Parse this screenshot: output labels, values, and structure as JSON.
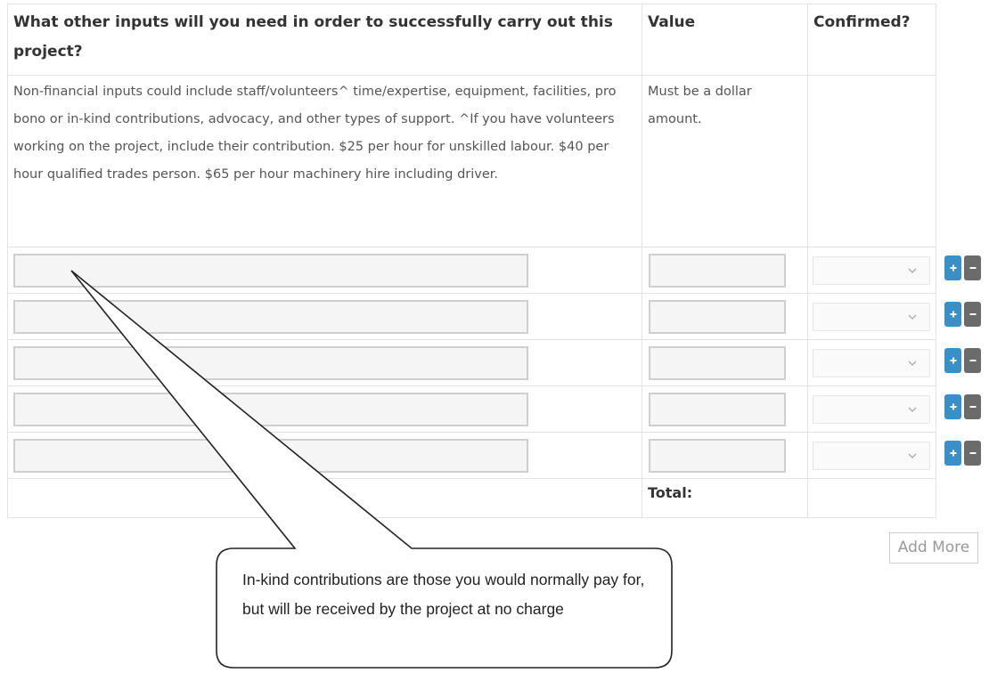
{
  "table": {
    "col_question": "What other inputs will you need in order to successfully carry out this project?",
    "col_value": "Value",
    "col_confirmed": "Confirmed?",
    "desc_question": "Non-financial inputs could include staff/volunteers^ time/expertise, equipment, facilities, pro bono or in-kind contributions, advocacy, and other types of support. ^If you have volunteers working on the project, include their contribution. $25 per hour for unskilled labour. $40 per hour qualified trades person. $65 per hour machinery hire including driver.",
    "desc_value": "Must be a dollar amount.",
    "total_label": "Total:"
  },
  "rows": [
    {
      "input": "",
      "value": "",
      "confirmed": ""
    },
    {
      "input": "",
      "value": "",
      "confirmed": ""
    },
    {
      "input": "",
      "value": "",
      "confirmed": ""
    },
    {
      "input": "",
      "value": "",
      "confirmed": ""
    },
    {
      "input": "",
      "value": "",
      "confirmed": ""
    }
  ],
  "add_more_label": "Add More",
  "callout": {
    "text": "In-kind contributions are those you would normally pay for, but will be received by the project at no charge"
  },
  "colors": {
    "plus_button": "#3a8fc7",
    "minus_button": "#6b6b6b",
    "border": "#e3e3e3"
  },
  "icons": {
    "add_row": "plus-icon",
    "remove_row": "minus-icon",
    "dropdown": "chevron-down-icon"
  }
}
